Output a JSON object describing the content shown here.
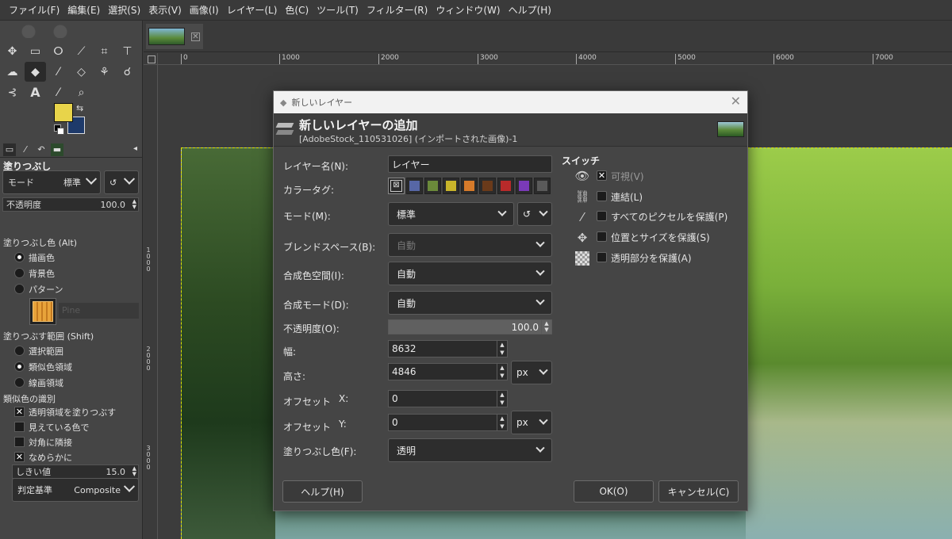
{
  "menubar": [
    "ファイル(F)",
    "編集(E)",
    "選択(S)",
    "表示(V)",
    "画像(I)",
    "レイヤー(L)",
    "色(C)",
    "ツール(T)",
    "フィルター(R)",
    "ウィンドウ(W)",
    "ヘルプ(H)"
  ],
  "tool_options": {
    "title": "塗りつぶし",
    "mode_label": "モード",
    "mode_value": "標準",
    "opacity_label": "不透明度",
    "opacity_value": "100.0",
    "fill_color_label": "塗りつぶし色 (Alt)",
    "fill_options": [
      "描画色",
      "背景色",
      "パターン"
    ],
    "fill_selected": "描画色",
    "pattern_name": "Pine",
    "fill_range_label": "塗りつぶす範囲 (Shift)",
    "range_options": [
      "選択範囲",
      "類似色領域",
      "線画領域"
    ],
    "range_selected": "類似色領域",
    "similar_label": "類似色の識別",
    "checks": [
      {
        "label": "透明領域を塗りつぶす",
        "checked": true
      },
      {
        "label": "見えている色で",
        "checked": false
      },
      {
        "label": "対角に隣接",
        "checked": false
      },
      {
        "label": "なめらかに",
        "checked": true
      }
    ],
    "threshold_label": "しきい値",
    "threshold_value": "15.0",
    "criterion_label": "判定基準",
    "criterion_value": "Composite"
  },
  "colors": {
    "foreground": "#e8d44a",
    "background": "#1e3a6a",
    "accent": "#e4e400"
  },
  "ruler": {
    "top_ticks": [
      "0",
      "1000",
      "2000",
      "3000",
      "4000",
      "5000",
      "6000",
      "7000"
    ],
    "left_ticks": [
      "1000",
      "2000",
      "3000"
    ]
  },
  "dialog": {
    "window_title": "新しいレイヤー",
    "heading": "新しいレイヤーの追加",
    "subheading": "[AdobeStock_110531026] (インポートされた画像)-1",
    "fields": {
      "layer_name_label": "レイヤー名(N):",
      "layer_name_value": "レイヤー",
      "color_tag_label": "カラータグ:",
      "mode_label": "モード(M):",
      "mode_value": "標準",
      "blend_space_label": "ブレンドスペース(B):",
      "blend_space_value": "自動",
      "composite_space_label": "合成色空間(I):",
      "composite_space_value": "自動",
      "composite_mode_label": "合成モード(D):",
      "composite_mode_value": "自動",
      "opacity_label": "不透明度(O):",
      "opacity_value": "100.0",
      "opacity_fraction": 1.0,
      "width_label": "幅:",
      "width_value": "8632",
      "height_label": "高さ:",
      "height_value": "4846",
      "unit_value": "px",
      "offset_label": "オフセット",
      "offset_x_label": "X:",
      "offset_x_value": "0",
      "offset_y_label": "Y:",
      "offset_y_value": "0",
      "fill_label": "塗りつぶし色(F):",
      "fill_value": "透明"
    },
    "color_tags": [
      "#2b2b2b",
      "#5767a6",
      "#6b8a3a",
      "#c8b42a",
      "#d67a2a",
      "#6a3a1a",
      "#b82a2a",
      "#7a3ab8",
      "#5a5a5a"
    ],
    "switches": {
      "title": "スイッチ",
      "items": [
        {
          "label": "可視(V)",
          "checked": true,
          "icon": "eye-icon"
        },
        {
          "label": "連結(L)",
          "checked": false,
          "icon": "chain-icon"
        },
        {
          "label": "すべてのピクセルを保護(P)",
          "checked": false,
          "icon": "brush-icon"
        },
        {
          "label": "位置とサイズを保護(S)",
          "checked": false,
          "icon": "move-icon"
        },
        {
          "label": "透明部分を保護(A)",
          "checked": false,
          "icon": "checkerboard-icon"
        }
      ]
    },
    "buttons": {
      "help": "ヘルプ(H)",
      "ok": "OK(O)",
      "cancel": "キャンセル(C)"
    }
  }
}
